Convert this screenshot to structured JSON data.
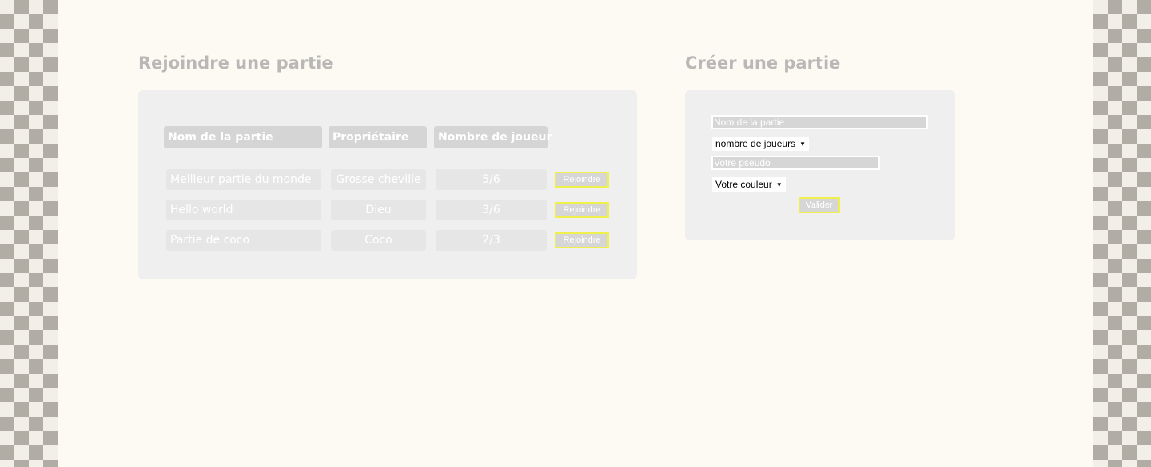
{
  "join": {
    "title": "Rejoindre une partie",
    "headers": [
      "Nom de la partie",
      "Propriétaire",
      "Nombre de joueur"
    ],
    "games": [
      {
        "name": "Meilleur partie du monde",
        "owner": "Grosse cheville",
        "players": "5/6",
        "button": "Rejoindre"
      },
      {
        "name": "Hello world",
        "owner": "Dieu",
        "players": "3/6",
        "button": "Rejoindre"
      },
      {
        "name": "Partie de coco",
        "owner": "Coco",
        "players": "2/3",
        "button": "Rejoindre"
      }
    ]
  },
  "create": {
    "title": "Créer une partie",
    "name_placeholder": "Nom de la partie",
    "players_select": "nombre de joueurs",
    "pseudo_placeholder": "Votre pseudo",
    "color_select": "Votre couleur",
    "submit": "Valider"
  },
  "colors": {
    "button_border": "#f0f04a",
    "panel_bg": "#efeff0",
    "page_bg": "#fcfaf3",
    "checker_dark": "#b1aca4"
  }
}
